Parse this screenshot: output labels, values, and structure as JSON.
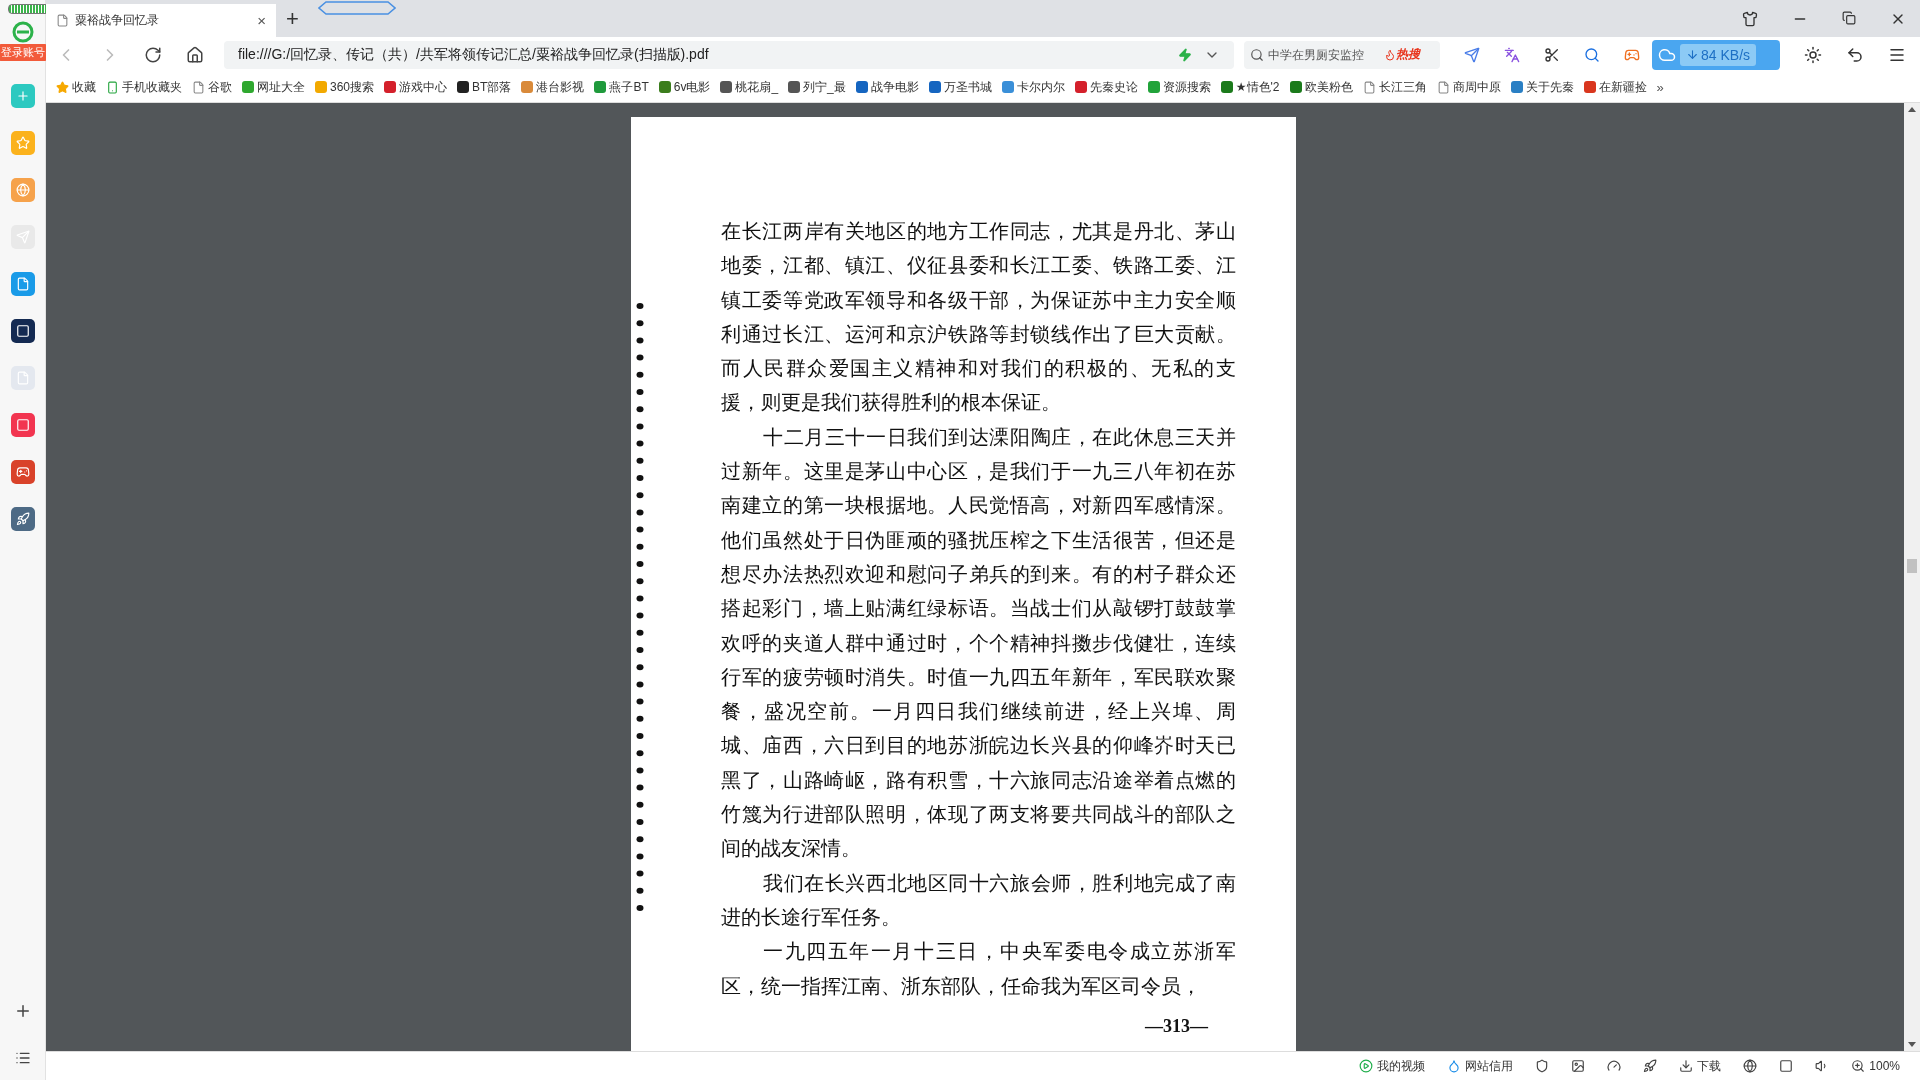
{
  "tab": {
    "title": "粟裕战争回忆录",
    "selected": true,
    "close": "×",
    "new_tab": "+"
  },
  "sidebar": {
    "login_badge": "登录账号"
  },
  "address_bar": {
    "url": "file:///G:/回忆录、传记（共）/共军将领传记汇总/粟裕战争回忆录(扫描版).pdf"
  },
  "search": {
    "placeholder": "中学在男厕安监控",
    "hot_label": "热搜"
  },
  "download_speed": "84 KB/s",
  "bookmarks": [
    {
      "kind": "star",
      "label": "收藏"
    },
    {
      "kind": "phone",
      "label": "手机收藏夹"
    },
    {
      "kind": "page",
      "label": "谷歌"
    },
    {
      "kind": "site",
      "label": "网址大全",
      "color": "#2fa82f"
    },
    {
      "kind": "site",
      "label": "360搜索",
      "color": "#f2a900"
    },
    {
      "kind": "site",
      "label": "游戏中心",
      "color": "#d4202b"
    },
    {
      "kind": "site",
      "label": "BT部落",
      "color": "#222222"
    },
    {
      "kind": "site",
      "label": "港台影视",
      "color": "#d98a3a"
    },
    {
      "kind": "site",
      "label": "燕子BT",
      "color": "#1f9a3c"
    },
    {
      "kind": "site",
      "label": "6v电影",
      "color": "#3b7d1c"
    },
    {
      "kind": "site",
      "label": "桃花扇_",
      "color": "#555555"
    },
    {
      "kind": "site",
      "label": "列宁_最",
      "color": "#555555"
    },
    {
      "kind": "site",
      "label": "战争电影",
      "color": "#1565c0"
    },
    {
      "kind": "site",
      "label": "万圣书城",
      "color": "#1565c0"
    },
    {
      "kind": "site",
      "label": "卡尔内尔",
      "color": "#3a8fd8"
    },
    {
      "kind": "site",
      "label": "先秦史论",
      "color": "#d4202b"
    },
    {
      "kind": "site",
      "label": "资源搜索",
      "color": "#21a33a"
    },
    {
      "kind": "site",
      "label": "★情色'2",
      "color": "#1b7a1b"
    },
    {
      "kind": "site",
      "label": "欧美粉色",
      "color": "#1b7a1b"
    },
    {
      "kind": "page",
      "label": "长江三角"
    },
    {
      "kind": "page",
      "label": "商周中原"
    },
    {
      "kind": "site",
      "label": "关于先秦",
      "color": "#2a7fc4"
    },
    {
      "kind": "site",
      "label": "在新疆捡",
      "color": "#d9361e"
    }
  ],
  "bookmarks_more": "»",
  "document": {
    "paragraphs": [
      {
        "indent": false,
        "lines": [
          "在长江两岸有关地区的地方工作同志，尤其是丹北、茅山",
          "地委，江都、镇江、仪征县委和长江工委、铁路工委、江",
          "镇工委等党政军领导和各级干部，为保证苏中主力安全顺",
          "利通过长江、运河和京沪铁路等封锁线作出了巨大贡献。",
          "而人民群众爱国主义精神和对我们的积极的、无私的支",
          "援，则更是我们获得胜利的根本保证。"
        ]
      },
      {
        "indent": true,
        "lines": [
          "十二月三十一日我们到达溧阳陶庄，在此休息三天并",
          "过新年。这里是茅山中心区，是我们于一九三八年初在苏",
          "南建立的第一块根据地。人民觉悟高，对新四军感情深。",
          "他们虽然处于日伪匪顽的骚扰压榨之下生活很苦，但还是",
          "想尽办法热烈欢迎和慰问子弟兵的到来。有的村子群众还",
          "搭起彩门，墙上贴满红绿标语。当战士们从敲锣打鼓鼓掌",
          "欢呼的夹道人群中通过时，个个精神抖擞步伐健壮，连续",
          "行军的疲劳顿时消失。时值一九四五年新年，军民联欢聚",
          "餐，盛况空前。一月四日我们继续前进，经上兴埠、周",
          "城、庙西，六日到目的地苏浙皖边长兴县的仰峰岕时天已",
          "黑了，山路崎岖，路有积雪，十六旅同志沿途举着点燃的",
          "竹篾为行进部队照明，体现了两支将要共同战斗的部队之",
          "间的战友深情。"
        ]
      },
      {
        "indent": true,
        "lines": [
          "我们在长兴西北地区同十六旅会师，胜利地完成了南",
          "进的长途行军任务。"
        ]
      },
      {
        "indent": true,
        "lines": [
          "一九四五年一月十三日，中央军委电令成立苏浙军",
          "区，统一指挥江南、浙东部队，任命我为军区司令员，"
        ]
      }
    ],
    "page_number": "—313—"
  },
  "status_bar": {
    "items": [
      {
        "kind": "video",
        "label": "我的视频"
      },
      {
        "kind": "credit",
        "label": "网站信用"
      },
      {
        "kind": "shield"
      },
      {
        "kind": "image"
      },
      {
        "kind": "speed"
      },
      {
        "kind": "rocket"
      },
      {
        "kind": "download",
        "label": "下载"
      },
      {
        "kind": "ie"
      },
      {
        "kind": "window"
      },
      {
        "kind": "sound"
      },
      {
        "kind": "zoom",
        "label": "100%"
      }
    ]
  }
}
